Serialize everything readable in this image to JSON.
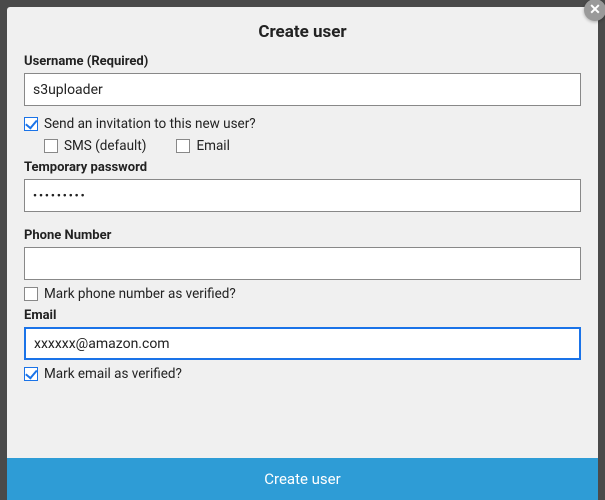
{
  "modal": {
    "title": "Create user",
    "close_icon": "✕"
  },
  "username": {
    "label": "Username (Required)",
    "value": "s3uploader"
  },
  "invitation": {
    "label": "Send an invitation to this new user?",
    "checked": true,
    "sms": {
      "label": "SMS (default)",
      "checked": false
    },
    "email": {
      "label": "Email",
      "checked": false
    }
  },
  "temp_password": {
    "label": "Temporary password",
    "value": "•••••••••"
  },
  "phone": {
    "label": "Phone Number",
    "value": "",
    "verify_label": "Mark phone number as verified?",
    "verify_checked": false
  },
  "email": {
    "label": "Email",
    "value": "xxxxxx@amazon.com",
    "verify_label": "Mark email as verified?",
    "verify_checked": true
  },
  "footer": {
    "submit_label": "Create user"
  }
}
